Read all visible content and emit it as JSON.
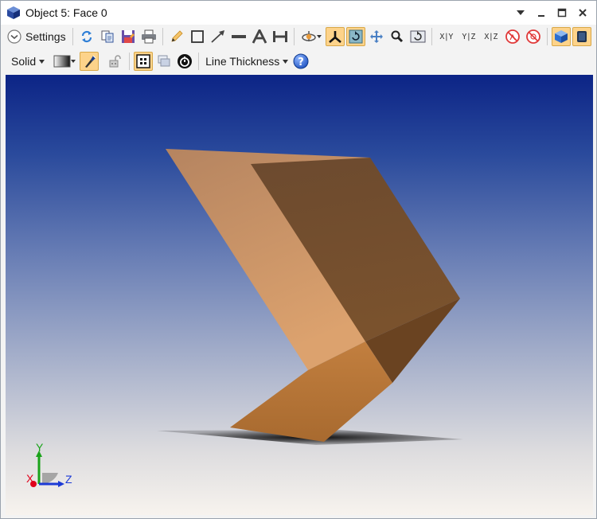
{
  "window": {
    "title": "Object 5: Face 0",
    "controls": {
      "menu": "menu-caret",
      "minimize": "minimize",
      "maximize": "maximize",
      "close": "close"
    }
  },
  "toolbar1": {
    "settings_label": "Settings",
    "axis_views": [
      "X|Y",
      "Y|Z",
      "X|Z"
    ]
  },
  "toolbar2": {
    "render_mode": "Solid",
    "line_thickness_label": "Line Thickness"
  },
  "triad": {
    "x_label": "X",
    "y_label": "Y",
    "z_label": "Z",
    "colors": {
      "x": "#e0001b",
      "y": "#1aa31a",
      "z": "#1c3ad6"
    }
  },
  "colors": {
    "accent_active": "#fdd38a",
    "object_light": "#d79b69",
    "object_dark": "#6e4a2c"
  }
}
